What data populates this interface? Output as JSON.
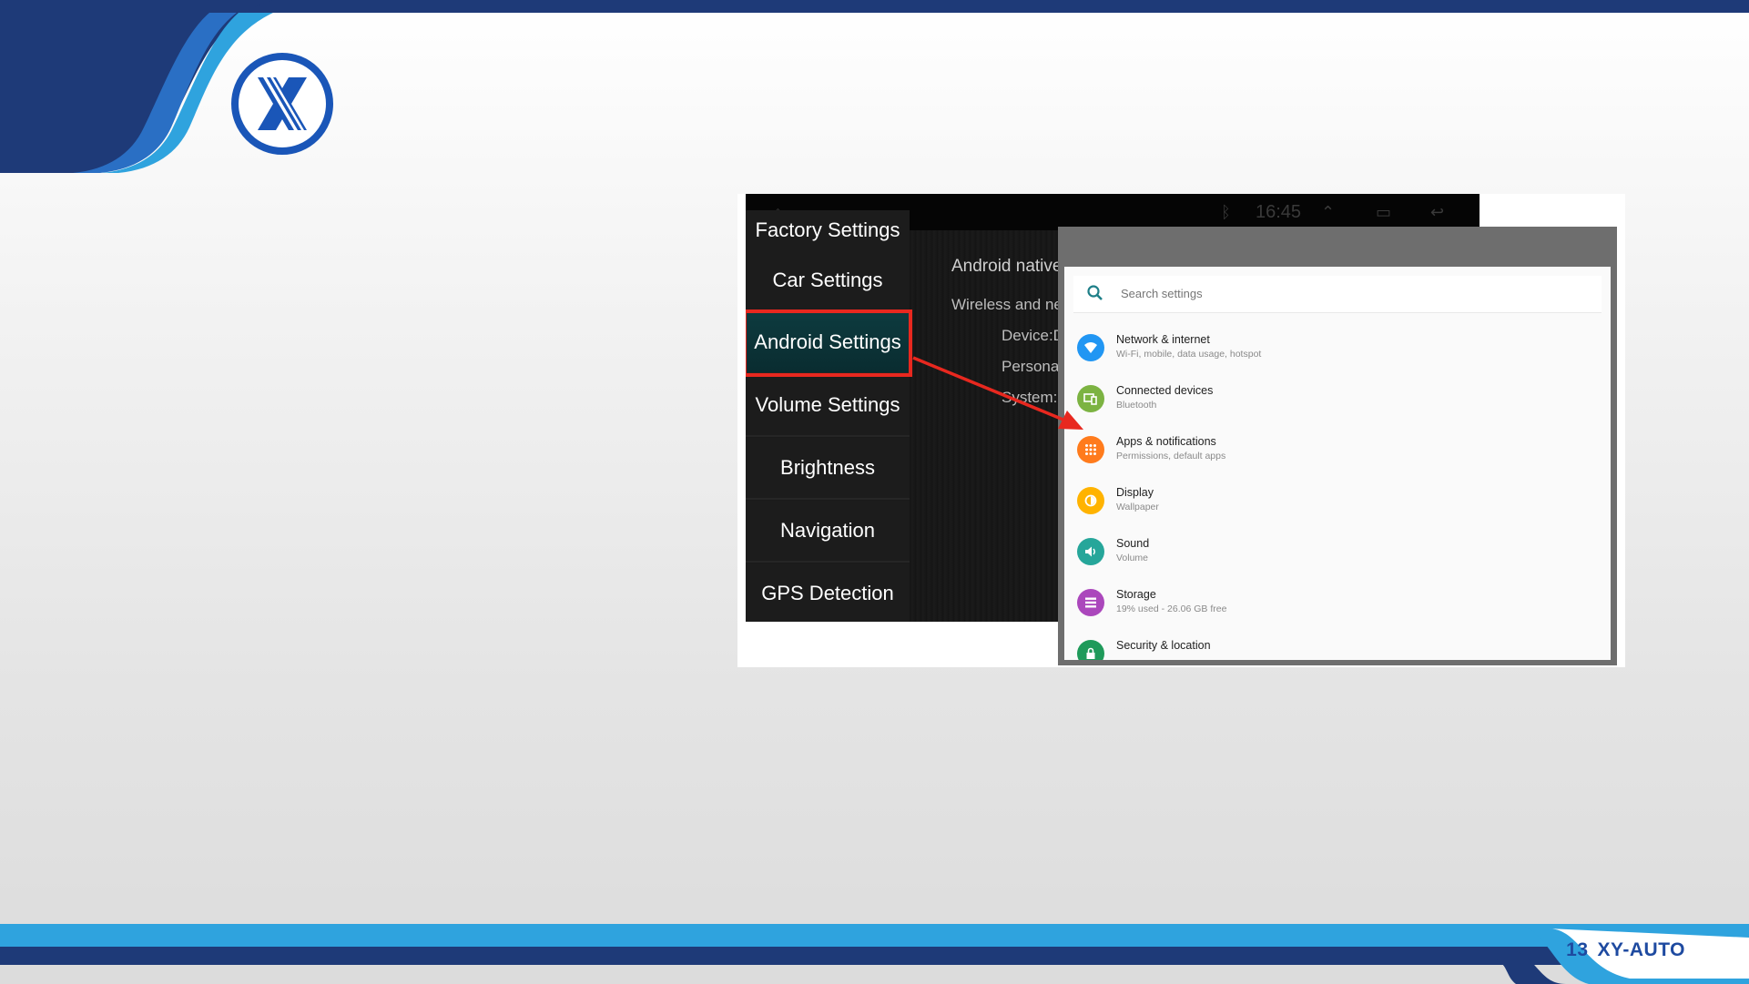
{
  "slide": {
    "page_number": "13",
    "brand": "XY-AUTO",
    "colors": {
      "navy": "#1e3a78",
      "blue": "#2a73c9",
      "light_blue": "#2fa3de",
      "highlight": "#e8281f"
    }
  },
  "car_screen": {
    "time": "16:45",
    "menu": [
      {
        "label": "Factory Settings"
      },
      {
        "label": "Car Settings"
      },
      {
        "label": "Android Settings",
        "active": true
      },
      {
        "label": "Volume Settings"
      },
      {
        "label": "Brightness"
      },
      {
        "label": "Navigation"
      },
      {
        "label": "GPS Detection"
      }
    ],
    "panel": {
      "heading": "Android native",
      "subheading": "Wireless and net",
      "items": [
        "Device:D",
        "Personal",
        "System:c"
      ]
    }
  },
  "android_settings": {
    "search_placeholder": "Search settings",
    "items": [
      {
        "title": "Network & internet",
        "subtitle": "Wi-Fi, mobile, data usage, hotspot",
        "icon": "wifi-icon",
        "color": "#2196f3"
      },
      {
        "title": "Connected devices",
        "subtitle": "Bluetooth",
        "icon": "devices-icon",
        "color": "#7cb342"
      },
      {
        "title": "Apps & notifications",
        "subtitle": "Permissions, default apps",
        "icon": "apps-icon",
        "color": "#ff7b1c"
      },
      {
        "title": "Display",
        "subtitle": "Wallpaper",
        "icon": "brightness-icon",
        "color": "#ffb300"
      },
      {
        "title": "Sound",
        "subtitle": "Volume",
        "icon": "volume-icon",
        "color": "#26a69a"
      },
      {
        "title": "Storage",
        "subtitle": "19% used - 26.06 GB free",
        "icon": "storage-icon",
        "color": "#ab47bc"
      },
      {
        "title": "Security & location",
        "subtitle": "",
        "icon": "lock-icon",
        "color": "#1f9a5a"
      }
    ]
  }
}
